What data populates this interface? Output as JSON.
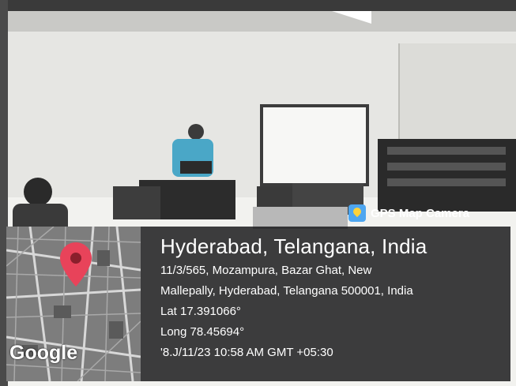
{
  "app": {
    "name": "GPS Map Camera"
  },
  "location": {
    "city": "Hyderabad, Telangana, India",
    "address_line1": "11/3/565, Mozampura, Bazar Ghat, New",
    "address_line2": "Mallepally, Hyderabad, Telangana 500001, India",
    "latitude": "Lat 17.391066°",
    "longitude": "Long 78.45694°",
    "datetime": "'8.J/11/23 10:58 AM GMT +05:30"
  },
  "map": {
    "provider_logo": "Google",
    "pin_icon": "map-pin-icon",
    "pin_color": "#e8435a"
  }
}
